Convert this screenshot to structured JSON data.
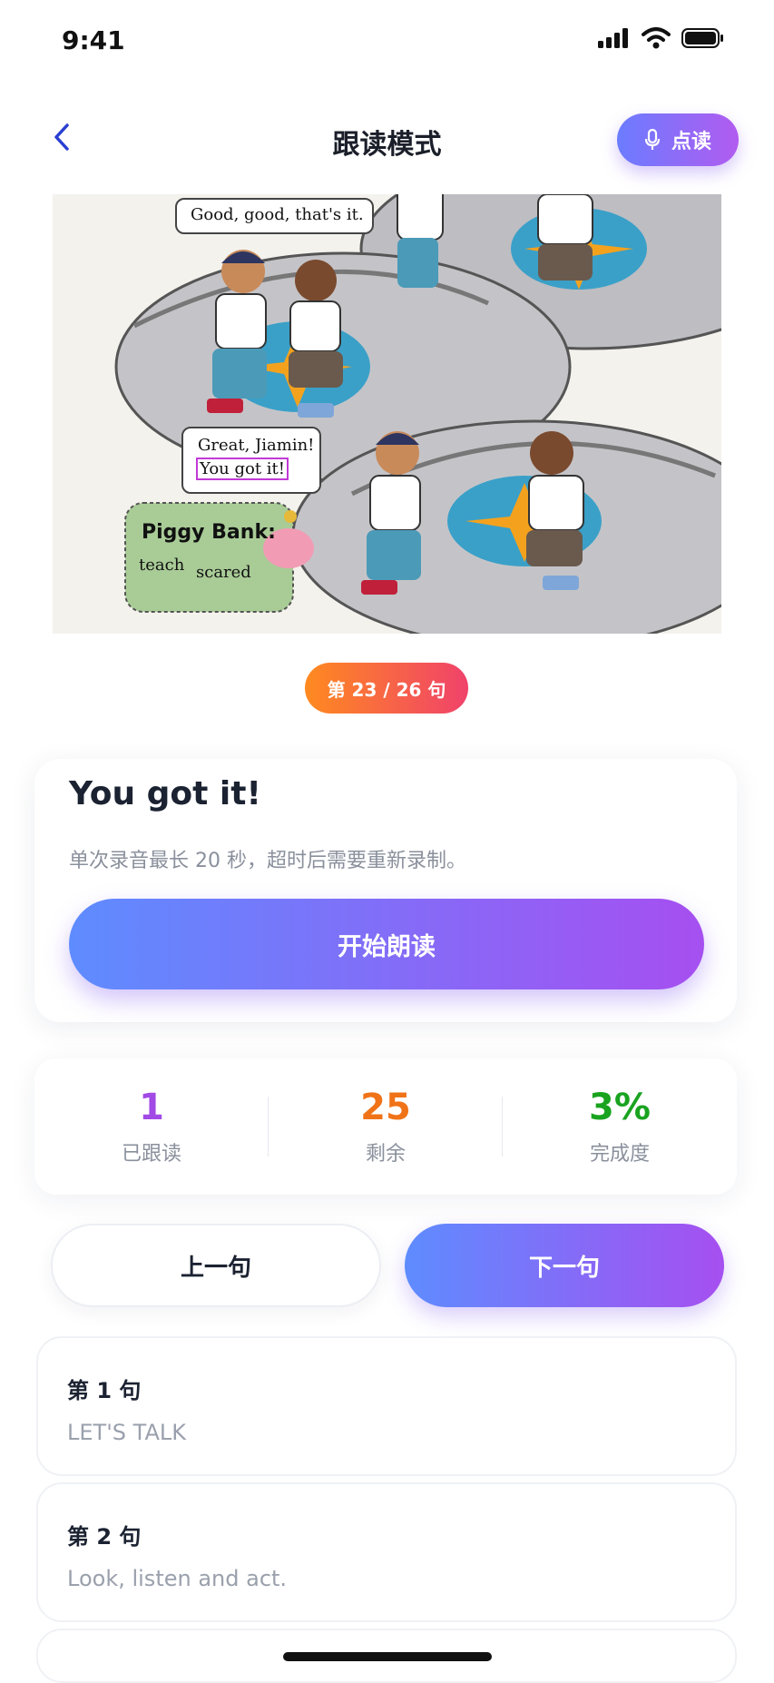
{
  "status": {
    "time": "9:41"
  },
  "nav": {
    "title": "跟读模式",
    "read_button": "点读"
  },
  "illustration": {
    "bubble_1": "Good, good, that's it.",
    "bubble_2_line1": "Great, Jiamin!",
    "bubble_2_line2": "You got it!",
    "piggy_title": "Piggy Bank:",
    "piggy_word1": "teach",
    "piggy_word2": "scared"
  },
  "progress_chip": "第 23 / 26 句",
  "current": {
    "sentence": "You got it!",
    "hint": "单次录音最长 20 秒，超时后需要重新录制。",
    "start_label": "开始朗读"
  },
  "stats": [
    {
      "value": "1",
      "label": "已跟读",
      "color": "#a24ae6"
    },
    {
      "value": "25",
      "label": "剩余",
      "color": "#f07318"
    },
    {
      "value": "3%",
      "label": "完成度",
      "color": "#19a31f"
    }
  ],
  "controls": {
    "prev": "上一句",
    "next": "下一句"
  },
  "sentences": [
    {
      "title": "第 1 句",
      "text": "LET'S TALK"
    },
    {
      "title": "第 2 句",
      "text": "Look, listen and act."
    }
  ]
}
